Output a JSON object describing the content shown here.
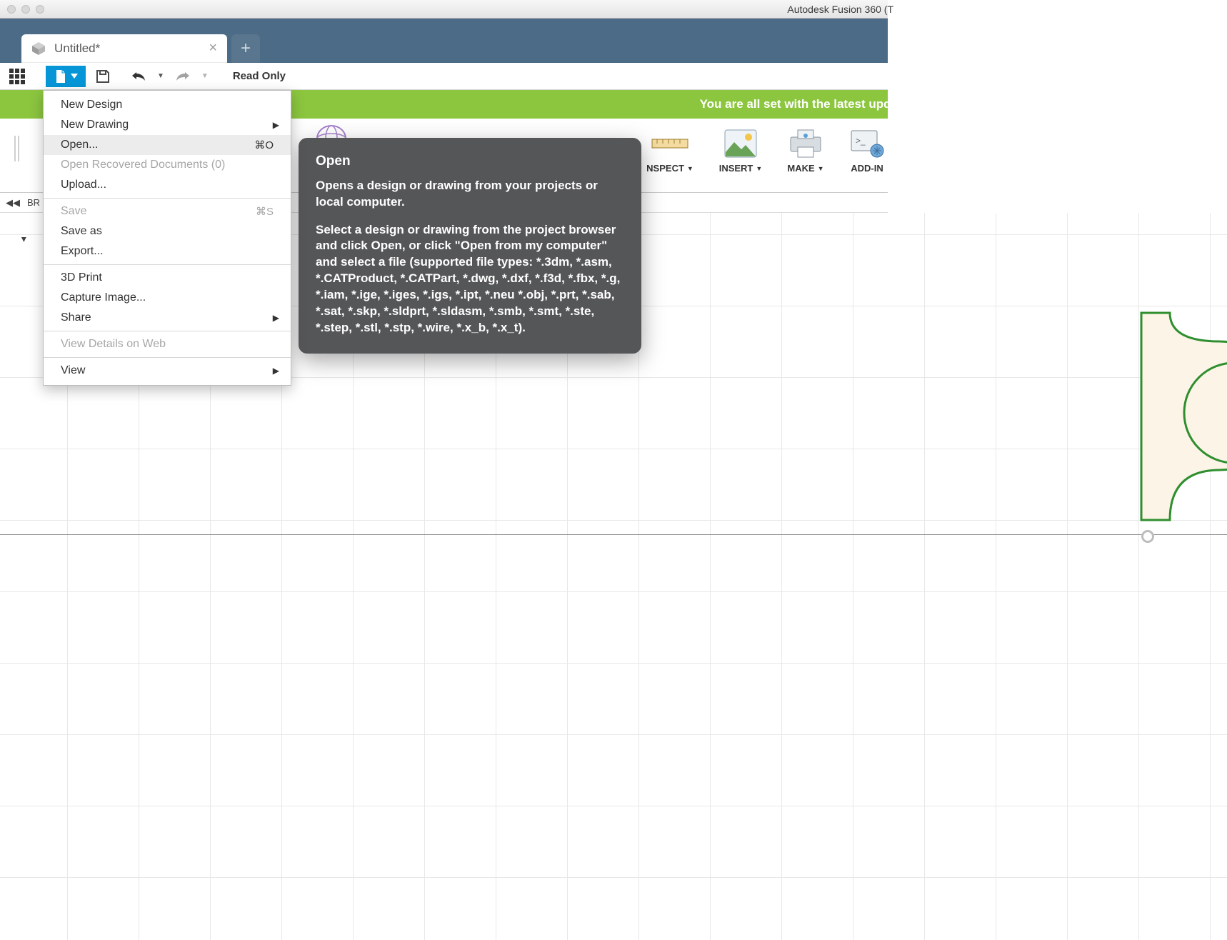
{
  "window": {
    "app_title": "Autodesk Fusion 360 (T"
  },
  "tabs": {
    "active_label": "Untitled*"
  },
  "toolbar": {
    "read_only": "Read Only"
  },
  "banner": {
    "text": "You are all set with the latest upda"
  },
  "ribbon": {
    "inspect": "NSPECT",
    "insert": "INSERT",
    "make": "MAKE",
    "addins": "ADD-IN"
  },
  "browser": {
    "label": "BR"
  },
  "file_menu": {
    "items": [
      {
        "label": "New Design",
        "shortcut": "",
        "submenu": false,
        "disabled": false
      },
      {
        "label": "New Drawing",
        "shortcut": "",
        "submenu": true,
        "disabled": false
      },
      {
        "label": "Open...",
        "shortcut": "⌘O",
        "submenu": false,
        "disabled": false,
        "highlight": true
      },
      {
        "label": "Open Recovered Documents (0)",
        "shortcut": "",
        "submenu": false,
        "disabled": true
      },
      {
        "label": "Upload...",
        "shortcut": "",
        "submenu": false,
        "disabled": false
      },
      {
        "sep": true
      },
      {
        "label": "Save",
        "shortcut": "⌘S",
        "submenu": false,
        "disabled": true
      },
      {
        "label": "Save as",
        "shortcut": "",
        "submenu": false,
        "disabled": false
      },
      {
        "label": "Export...",
        "shortcut": "",
        "submenu": false,
        "disabled": false
      },
      {
        "sep": true
      },
      {
        "label": "3D Print",
        "shortcut": "",
        "submenu": false,
        "disabled": false
      },
      {
        "label": "Capture Image...",
        "shortcut": "",
        "submenu": false,
        "disabled": false
      },
      {
        "label": "Share",
        "shortcut": "",
        "submenu": true,
        "disabled": false
      },
      {
        "sep": true
      },
      {
        "label": "View Details on Web",
        "shortcut": "",
        "submenu": false,
        "disabled": true
      },
      {
        "sep": true
      },
      {
        "label": "View",
        "shortcut": "",
        "submenu": true,
        "disabled": false
      }
    ]
  },
  "tooltip": {
    "title": "Open",
    "p1": "Opens a design or drawing from your projects or local computer.",
    "p2": "Select a design or drawing from the project browser and click Open, or click \"Open from my computer\" and select a file (supported file types: *.3dm, *.asm, *.CATProduct, *.CATPart, *.dwg, *.dxf, *.f3d, *.fbx, *.g, *.iam, *.ige, *.iges, *.igs, *.ipt, *.neu *.obj, *.prt, *.sab, *.sat, *.skp, *.sldprt, *.sldasm, *.smb, *.smt, *.ste, *.step, *.stl, *.stp, *.wire, *.x_b, *.x_t)."
  }
}
